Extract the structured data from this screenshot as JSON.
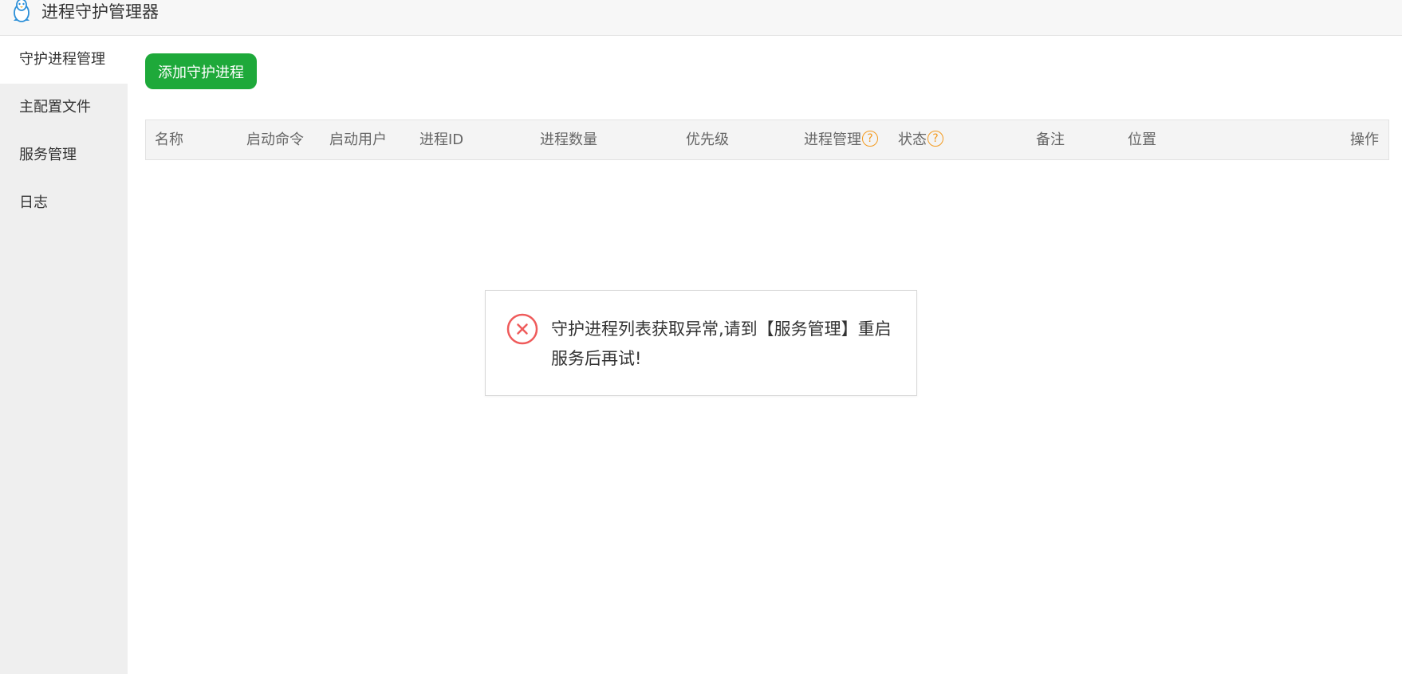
{
  "app": {
    "title": "进程守护管理器",
    "logo_icon": "linux-penguin-icon"
  },
  "sidebar": {
    "items": [
      {
        "label": "守护进程管理",
        "active": true
      },
      {
        "label": "主配置文件",
        "active": false
      },
      {
        "label": "服务管理",
        "active": false
      },
      {
        "label": "日志",
        "active": false
      }
    ]
  },
  "toolbar": {
    "add_label": "添加守护进程",
    "add_color": "#1ea93a"
  },
  "table": {
    "columns": [
      "名称",
      "启动命令",
      "启动用户",
      "进程ID",
      "进程数量",
      "优先级",
      "进程管理",
      "状态",
      "备注",
      "位置",
      "操作"
    ],
    "help_mark": "?",
    "help_color": "#f39a1e",
    "rows": []
  },
  "toast": {
    "type": "error",
    "icon": "error-circle-x-icon",
    "icon_color": "#ef5b5b",
    "message": "守护进程列表获取异常,请到【服务管理】重启服务后再试!"
  }
}
